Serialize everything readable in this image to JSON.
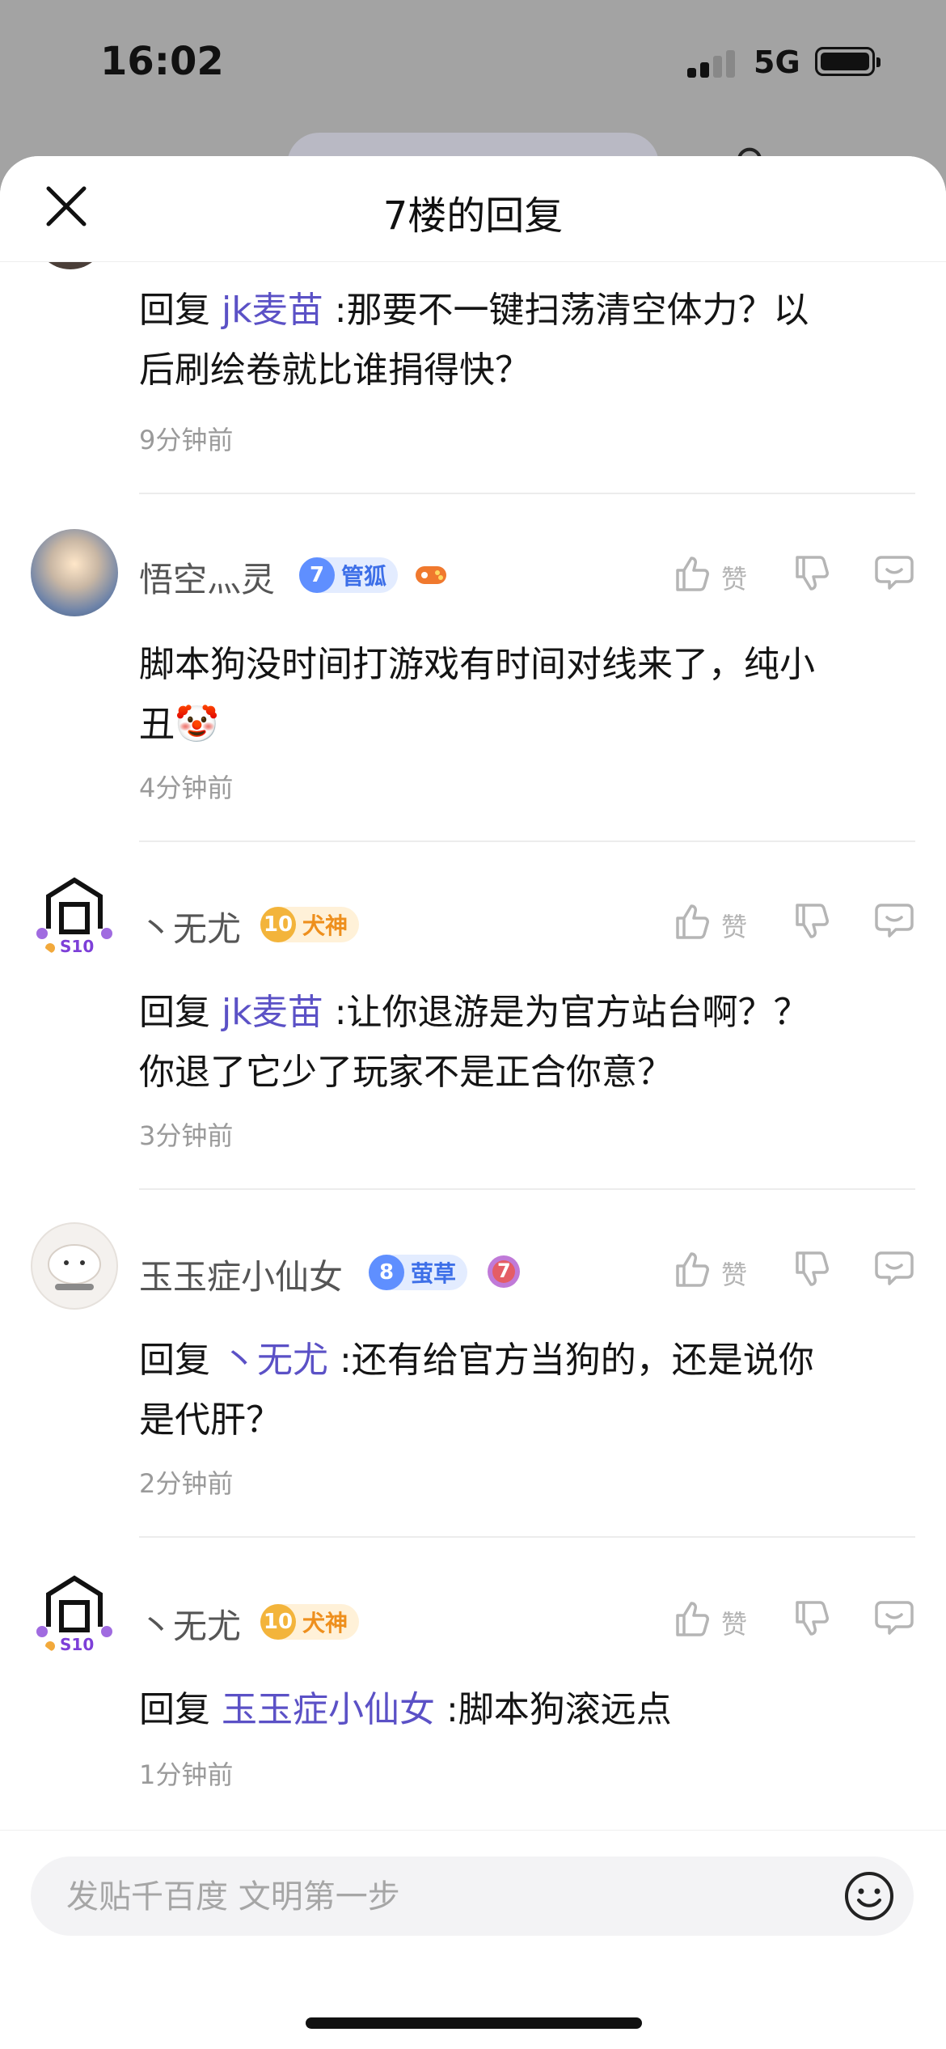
{
  "status": {
    "time": "16:02",
    "network": "5G"
  },
  "sheet": {
    "title": "7楼的回复"
  },
  "comments": [
    {
      "reply_prefix": "回复 ",
      "mention": "jk麦苗",
      "line1": " :那要不一键扫荡清空体力？以",
      "line2": "后刷绘卷就比谁捐得快？",
      "time": "9分钟前"
    },
    {
      "user": "悟空灬灵",
      "level": "7",
      "level_name": "管狐",
      "line1": "脚本狗没时间打游戏有时间对线来了，纯小",
      "line2": "丑🤡",
      "time": "4分钟前",
      "like_label": "赞"
    },
    {
      "user": "丶无尤",
      "level": "10",
      "level_name": "犬神",
      "avatar_tag": "S10",
      "reply_prefix": "回复 ",
      "mention": "jk麦苗",
      "line1": " :让你退游是为官方站台啊？？",
      "line2": "你退了它少了玩家不是正合你意？",
      "time": "3分钟前",
      "like_label": "赞"
    },
    {
      "user": "玉玉症小仙女",
      "level": "8",
      "level_name": "萤草",
      "medal": "7",
      "reply_prefix": "回复 ",
      "mention": "丶无尤",
      "line1": " :还有给官方当狗的，还是说你",
      "line2": "是代肝？",
      "time": "2分钟前",
      "like_label": "赞"
    },
    {
      "user": "丶无尤",
      "level": "10",
      "level_name": "犬神",
      "avatar_tag": "S10",
      "reply_prefix": "回复 ",
      "mention": "玉玉症小仙女",
      "line1": " :脚本狗滚远点",
      "time": "1分钟前",
      "like_label": "赞"
    }
  ],
  "input": {
    "placeholder": "发贴千百度 文明第一步"
  },
  "colors": {
    "mention": "#5b51c6",
    "sheet_bg": "#ffffff",
    "backdrop": "#a3a3a3"
  }
}
